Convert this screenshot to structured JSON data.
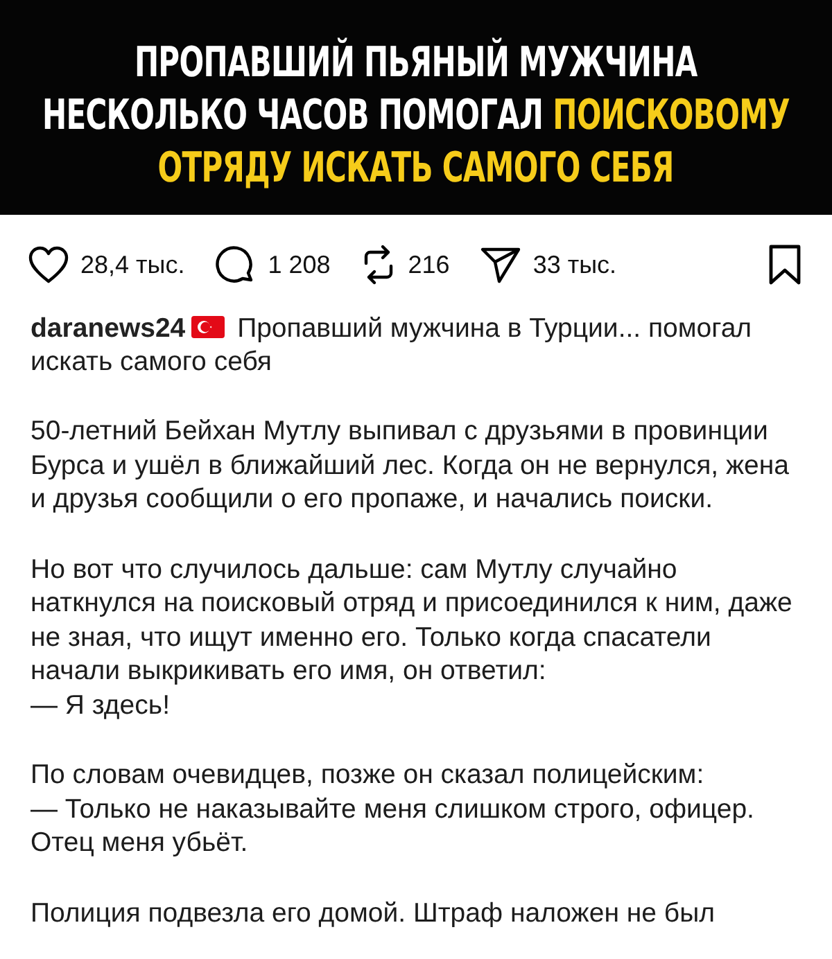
{
  "banner": {
    "lines": [
      [
        {
          "text": "ПРОПАВШИЙ ПЬЯНЫЙ МУЖЧИНА",
          "highlighted": false
        }
      ],
      [
        {
          "text": "НЕСКОЛЬКО ЧАСОВ ПОМОГАЛ ",
          "highlighted": false
        },
        {
          "text": "ПОИСКОВОМУ",
          "highlighted": true
        }
      ],
      [
        {
          "text": "ОТРЯДУ ИСКАТЬ САМОГО СЕБЯ",
          "highlighted": true
        }
      ]
    ]
  },
  "actions": [
    {
      "kind": "like",
      "count": "28,4 тыс."
    },
    {
      "kind": "comment",
      "count": "1 208"
    },
    {
      "kind": "repost",
      "count": "216"
    },
    {
      "kind": "share",
      "count": "33 тыс."
    }
  ],
  "saved": false,
  "caption": {
    "username": "daranews24",
    "text": "Пропавший мужчина в Турции... помогал искать самого себя"
  },
  "paragraphs": [
    "50-летний Бейхан Мутлу выпивал с друзьями в провинции Бурса и ушёл в ближайший лес. Когда он не вернулся, жена и друзья сообщили о его пропаже, и начались поиски.",
    "Но вот что случилось дальше: сам Мутлу случайно наткнулся на поисковый отряд и присоединился к ним, даже не зная, что ищут именно его. Только когда спасатели начали выкрикивать его имя, он ответил:\n— Я здесь!",
    "По словам очевидцев, позже он сказал полицейским:\n— Только не наказывайте меня слишком строго, офицер. Отец меня убьёт.",
    "Полиция подвезла его домой. Штраф наложен не был"
  ]
}
